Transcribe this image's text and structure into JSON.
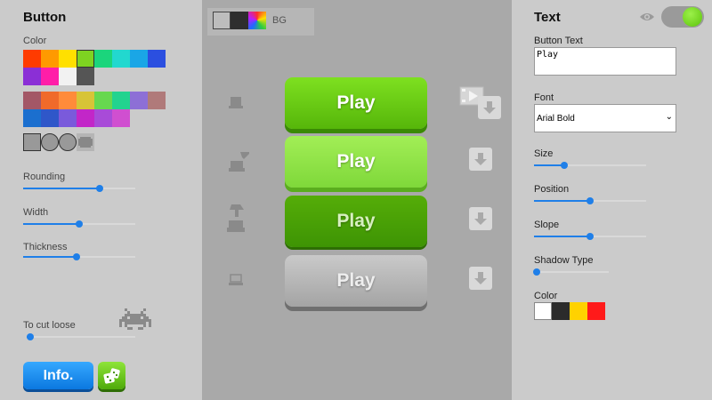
{
  "left": {
    "title": "Button",
    "color_label": "Color",
    "palette_row1": [
      "#ff3b00",
      "#ff9a00",
      "#ffe000",
      "#7ed321",
      "#1bd57c",
      "#22d8cf",
      "#1aa6e6",
      "#2b4fe0"
    ],
    "palette_row2": [
      "#8b2fd6",
      "#ff1ea8",
      "#f2f2f2",
      "#555555"
    ],
    "palette_row3": [
      "#a35766",
      "#f06a2a",
      "#ff8b3a",
      "#d7c437",
      "#67d84f",
      "#22d38f",
      "#8d6fd6",
      "#b07a7a"
    ],
    "palette_row4": [
      "#1b6fcf",
      "#2f57c9",
      "#7a5adb",
      "#c226c8",
      "#a84bd8",
      "#d04fd0"
    ],
    "sliders": [
      {
        "label": "Rounding",
        "value": 0.68
      },
      {
        "label": "Width",
        "value": 0.5
      },
      {
        "label": "Thickness",
        "value": 0.48
      }
    ],
    "cut_label": "To cut loose",
    "cut_value": 0.03,
    "info_label": "Info."
  },
  "middle": {
    "bg_label": "BG",
    "buttons": [
      {
        "label": "Play",
        "color": "#5ec40a",
        "state": "normal"
      },
      {
        "label": "Play",
        "color": "#86e03a",
        "state": "hover"
      },
      {
        "label": "Play",
        "color": "#449c06",
        "state": "pressed"
      },
      {
        "label": "Play",
        "color": "#a9a9a9",
        "state": "disabled"
      }
    ]
  },
  "right": {
    "title": "Text",
    "button_text_label": "Button Text",
    "button_text_value": "Play",
    "font_label": "Font",
    "font_value": "Arial Bold",
    "sliders": [
      {
        "label": "Size",
        "value": 0.27
      },
      {
        "label": "Position",
        "value": 0.5
      },
      {
        "label": "Slope",
        "value": 0.5
      },
      {
        "label": "Shadow Type",
        "value": 0.04
      }
    ],
    "color_label": "Color",
    "colors": [
      "#ffffff",
      "#2b2b2b",
      "#ffd200",
      "#ff1a1a"
    ]
  }
}
